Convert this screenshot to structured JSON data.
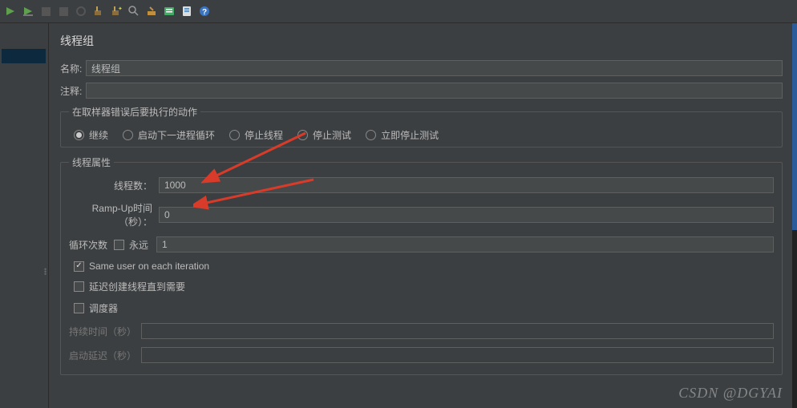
{
  "toolbar": {
    "icons": [
      "play",
      "play-noanim",
      "stop",
      "stop-all",
      "shutdown",
      "broom1",
      "broom2",
      "search",
      "clear",
      "clipboard",
      "report",
      "help"
    ]
  },
  "panel": {
    "title": "线程组",
    "name_label": "名称:",
    "name_value": "线程组",
    "comment_label": "注释:",
    "comment_value": ""
  },
  "error_group": {
    "legend": "在取样器错误后要执行的动作",
    "options": [
      {
        "label": "继续",
        "checked": true
      },
      {
        "label": "启动下一进程循环",
        "checked": false
      },
      {
        "label": "停止线程",
        "checked": false
      },
      {
        "label": "停止测试",
        "checked": false
      },
      {
        "label": "立即停止测试",
        "checked": false
      }
    ]
  },
  "props": {
    "legend": "线程属性",
    "threads_label": "线程数：",
    "threads_value": "1000",
    "ramp_label": "Ramp-Up时间（秒）：",
    "ramp_value": "0",
    "loop_label": "循环次数",
    "loop_forever": "永远",
    "loop_forever_checked": false,
    "loop_value": "1",
    "same_user": {
      "label": "Same user on each iteration",
      "checked": true
    },
    "delay_create": {
      "label": "延迟创建线程直到需要",
      "checked": false
    },
    "scheduler": {
      "label": "调度器",
      "checked": false
    },
    "duration_label": "持续时间（秒）",
    "duration_value": "",
    "startup_label": "启动延迟（秒）",
    "startup_value": ""
  },
  "watermark": "CSDN @DGYAI"
}
